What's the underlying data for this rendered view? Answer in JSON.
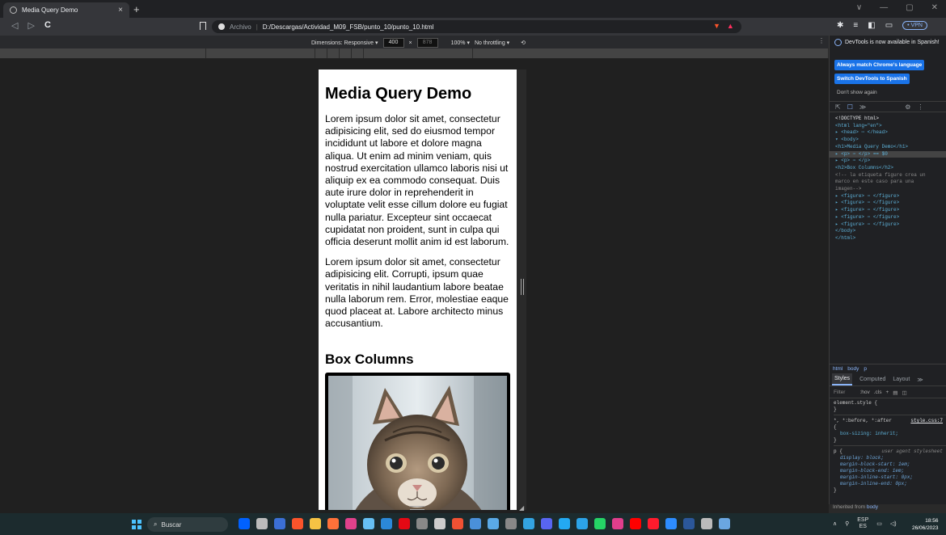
{
  "browser": {
    "tab_title": "Media Query Demo",
    "tab_close": "×",
    "new_tab": "+",
    "window_controls": [
      "∨",
      "—",
      "▢",
      "✕"
    ],
    "nav": {
      "back": "◁",
      "forward": "▷",
      "reload": "C"
    },
    "address": {
      "scheme_label": "Archivo",
      "separator": "|",
      "url": "D:/Descargas/Actividad_M09_FSB/punto_10/punto_10.html"
    },
    "vpn_label": "• VPN",
    "toolbar_icons": [
      "puzzle-icon",
      "playlist-icon",
      "sidebar-icon",
      "wallet-icon"
    ],
    "brand_color": "#fb542b"
  },
  "device_toolbar": {
    "dimensions_label": "Dimensions: Responsive ▾",
    "width": "400",
    "times": "×",
    "height": "878",
    "zoom": "100% ▾",
    "throttling": "No throttling ▾",
    "menu": "⋮"
  },
  "page": {
    "heading": "Media Query Demo",
    "paragraph1": "Lorem ipsum dolor sit amet, consectetur adipisicing elit, sed do eiusmod tempor incididunt ut labore et dolore magna aliqua. Ut enim ad minim veniam, quis nostrud exercitation ullamco laboris nisi ut aliquip ex ea commodo consequat. Duis aute irure dolor in reprehenderit in voluptate velit esse cillum dolore eu fugiat nulla pariatur. Excepteur sint occaecat cupidatat non proident, sunt in culpa qui officia deserunt mollit anim id est laborum.",
    "paragraph2": "Lorem ipsum dolor sit amet, consectetur adipisicing elit. Corrupti, ipsum quae veritatis in nihil laudantium labore beatae nulla laborum rem. Error, molestiae eaque quod placeat at. Labore architecto minus accusantium.",
    "subheading": "Box Columns"
  },
  "devtools": {
    "notice": "DevTools is now available in Spanish!",
    "button_match": "Always match Chrome's language",
    "button_switch": "Switch DevTools to Spanish",
    "dont_show": "Don't show again",
    "panel_tabs": [
      "⇱",
      "☐",
      "≫",
      "⚙",
      "⋮"
    ],
    "dom": [
      {
        "t": "<!DOCTYPE html>",
        "c": "tx"
      },
      {
        "t": "<html lang=\"en\">",
        "c": "tag"
      },
      {
        "t": "▸ <head> ⋯ </head>",
        "c": "tag"
      },
      {
        "t": "▾ <body>",
        "c": "tag"
      },
      {
        "t": "   <h1>Media Query Demo</h1>",
        "c": "tag"
      },
      {
        "t": " ▸ <p> ⋯ </p> == $0",
        "c": "tag",
        "sel": true
      },
      {
        "t": " ▸ <p> ⋯ </p>",
        "c": "tag"
      },
      {
        "t": "   <h2>Box Columns</h2>",
        "c": "tag"
      },
      {
        "t": "   <!-- la etiqueta figure crea un",
        "c": "cm"
      },
      {
        "t": "   marco en este caso para una",
        "c": "cm"
      },
      {
        "t": "   imagen-->",
        "c": "cm"
      },
      {
        "t": " ▸ <figure> ⋯ </figure>",
        "c": "tag"
      },
      {
        "t": " ▸ <figure> ⋯ </figure>",
        "c": "tag"
      },
      {
        "t": " ▸ <figure> ⋯ </figure>",
        "c": "tag"
      },
      {
        "t": " ▸ <figure> ⋯ </figure>",
        "c": "tag"
      },
      {
        "t": " ▸ <figure> ⋯ </figure>",
        "c": "tag"
      },
      {
        "t": "   </body>",
        "c": "tag"
      },
      {
        "t": "</html>",
        "c": "tag"
      }
    ],
    "breadcrumbs": [
      "html",
      "body",
      "p"
    ],
    "styles_tabs": [
      "Styles",
      "Computed",
      "Layout",
      "≫"
    ],
    "filter_placeholder": "Filter",
    "filter_tools": [
      ":hov",
      ".cls",
      "+"
    ],
    "rules": {
      "element_style": "element.style {",
      "close": "}",
      "universal_selector": "*, *:before, *:after",
      "universal_source": "style.css:7",
      "open": "{",
      "box_sizing": "box-sizing: inherit;",
      "p_selector": "p {",
      "ua_label": "user agent stylesheet",
      "ua_props": [
        "display: block;",
        "margin-block-start: 1em;",
        "margin-block-end: 1em;",
        "margin-inline-start: 0px;",
        "margin-inline-end: 0px;"
      ]
    },
    "inherited_prefix": "Inherited from",
    "inherited_link": "body"
  },
  "taskbar": {
    "search_label": "Buscar",
    "apps": [
      {
        "name": "dropbox-icon",
        "color": "#0061ff"
      },
      {
        "name": "files-icon",
        "color": "#bbbbbb"
      },
      {
        "name": "shield-app-icon",
        "color": "#3b6fd4"
      },
      {
        "name": "brave-icon",
        "color": "#fb542b"
      },
      {
        "name": "folder-icon",
        "color": "#f6c344"
      },
      {
        "name": "firefox-icon",
        "color": "#ff7139"
      },
      {
        "name": "app-store-icon",
        "color": "#e0418b"
      },
      {
        "name": "steam-icon",
        "color": "#66c0f4"
      },
      {
        "name": "calendar-icon",
        "color": "#2b88d8"
      },
      {
        "name": "netflix-icon",
        "color": "#e50914"
      },
      {
        "name": "chrome-icon",
        "color": "#888888"
      },
      {
        "name": "unity-icon",
        "color": "#cccccc"
      },
      {
        "name": "git-icon",
        "color": "#f05133"
      },
      {
        "name": "terminal-icon",
        "color": "#4a90d9"
      },
      {
        "name": "chart-app-icon",
        "color": "#5aa9e6"
      },
      {
        "name": "code-editor-icon",
        "color": "#888888"
      },
      {
        "name": "edge-icon",
        "color": "#33a4e2"
      },
      {
        "name": "discord-icon",
        "color": "#5865f2"
      },
      {
        "name": "vscode-icon",
        "color": "#23a9f2"
      },
      {
        "name": "teams-icon",
        "color": "#2ca3e8"
      },
      {
        "name": "whatsapp-icon",
        "color": "#25d366"
      },
      {
        "name": "photos-icon",
        "color": "#e03e8c"
      },
      {
        "name": "youtube-icon",
        "color": "#ff0000"
      },
      {
        "name": "opera-icon",
        "color": "#ff1b2d"
      },
      {
        "name": "zoom-icon",
        "color": "#2d8cff"
      },
      {
        "name": "word-icon",
        "color": "#2b579a"
      },
      {
        "name": "stats-icon",
        "color": "#bbbbbb"
      },
      {
        "name": "remote-icon",
        "color": "#6aa6e0"
      }
    ],
    "tray_chevron": "∧",
    "lang_top": "ESP",
    "lang_bottom": "ES",
    "time": "18:56",
    "date": "26/06/2023"
  }
}
